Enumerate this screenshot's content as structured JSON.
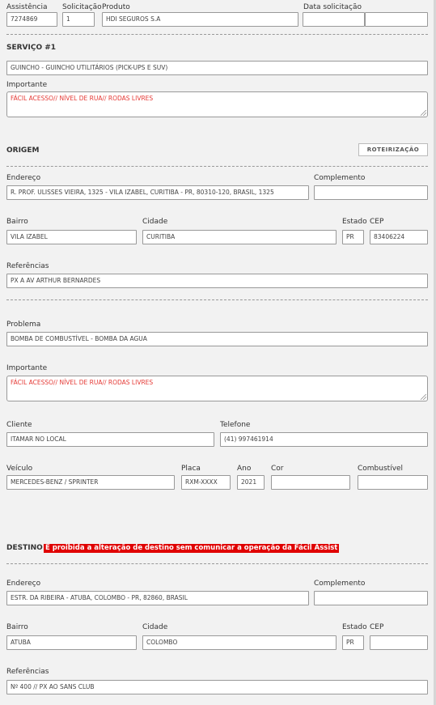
{
  "header": {
    "assistencia": {
      "label": "Assistência",
      "value": "7274869"
    },
    "solicitacao": {
      "label": "Solicitação",
      "value": "1"
    },
    "produto": {
      "label": "Produto",
      "value": "HDI SEGUROS S.A"
    },
    "data_solicitacao": {
      "label": "Data solicitação",
      "date_value": "",
      "time_value": ""
    }
  },
  "servico": {
    "title": "SERVIÇO #1",
    "value": "GUINCHO - GUINCHO UTILITÁRIOS (PICK-UPS E SUV)",
    "importante_label": "Importante",
    "importante_value": "FÁCIL ACESSO// NÍVEL DE RUA// RODAS LIVRES"
  },
  "origem": {
    "title": "ORIGEM",
    "button_label": "ROTEIRIZAÇÃO",
    "endereco": {
      "label": "Endereço",
      "value": "R. PROF. ULISSES VIEIRA, 1325 - VILA IZABEL, CURITIBA - PR, 80310-120, BRASIL, 1325"
    },
    "complemento": {
      "label": "Complemento",
      "value": ""
    },
    "bairro": {
      "label": "Bairro",
      "value": "VILA IZABEL"
    },
    "cidade": {
      "label": "Cidade",
      "value": "CURITIBA"
    },
    "estado": {
      "label": "Estado",
      "value": "PR"
    },
    "cep": {
      "label": "CEP",
      "value": "83406224"
    },
    "referencias": {
      "label": "Referências",
      "value": "PX A AV ARTHUR BERNARDES"
    }
  },
  "problema": {
    "label": "Problema",
    "value": "BOMBA DE COMBUSTÍVEL - BOMBA DA AGUA",
    "importante_label": "Importante",
    "importante_value": "FÁCIL ACESSO// NÍVEL DE RUA// RODAS LIVRES"
  },
  "cliente": {
    "cliente": {
      "label": "Cliente",
      "value": "ITAMAR NO LOCAL"
    },
    "telefone": {
      "label": "Telefone",
      "value": "(41) 997461914"
    }
  },
  "veiculo": {
    "veiculo": {
      "label": "Veículo",
      "value": "MERCEDES-BENZ / SPRINTER"
    },
    "placa": {
      "label": "Placa",
      "value": "RXM-XXXX"
    },
    "ano": {
      "label": "Ano",
      "value": "2021"
    },
    "cor": {
      "label": "Cor",
      "value": ""
    },
    "combustivel": {
      "label": "Combustível",
      "value": ""
    }
  },
  "destino": {
    "title": "DESTINO",
    "warning": "É proibida a alteração de destino sem comunicar a operação da Fácil Assist",
    "endereco": {
      "label": "Endereço",
      "value": "ESTR. DA RIBEIRA - ATUBA, COLOMBO - PR, 82860, BRASIL"
    },
    "complemento": {
      "label": "Complemento",
      "value": ""
    },
    "bairro": {
      "label": "Bairro",
      "value": "ATUBA"
    },
    "cidade": {
      "label": "Cidade",
      "value": "COLOMBO"
    },
    "estado": {
      "label": "Estado",
      "value": "PR"
    },
    "cep": {
      "label": "CEP",
      "value": ""
    },
    "referencias": {
      "label": "Referências",
      "value": "Nº 400 // PX AO SANS CLUB"
    }
  },
  "colors": {
    "background": "#f2f2f2",
    "important_text": "#e53935",
    "warning_bg": "#e00000"
  }
}
